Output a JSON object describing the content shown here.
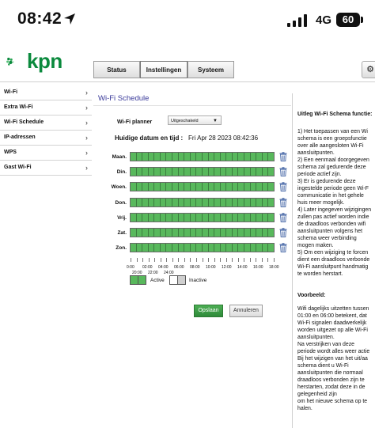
{
  "status_bar": {
    "time": "08:42",
    "network": "4G",
    "battery": "60"
  },
  "header": {
    "logo_text": "kpn",
    "tabs": [
      {
        "label": "Status",
        "active": false
      },
      {
        "label": "Instellingen",
        "active": true
      },
      {
        "label": "Systeem",
        "active": false
      }
    ],
    "help_icon": "gear-icon"
  },
  "sidebar": {
    "items": [
      {
        "label": "Wi-Fi"
      },
      {
        "label": "Extra Wi-Fi"
      },
      {
        "label": "Wi-Fi Schedule"
      },
      {
        "label": "IP-adressen"
      },
      {
        "label": "WPS"
      },
      {
        "label": "Gast Wi-Fi"
      }
    ]
  },
  "main": {
    "title": "Wi-Fi Schedule",
    "planner_label": "Wi-Fi planner",
    "planner_value": "Uitgeschakeld",
    "date_label": "Huidige datum en tijd :",
    "date_value": "Fri Apr 28 2023 08:42:36",
    "days": [
      {
        "label": "Maan."
      },
      {
        "label": "Din."
      },
      {
        "label": "Woen."
      },
      {
        "label": "Don."
      },
      {
        "label": "Vrij."
      },
      {
        "label": "Zat."
      },
      {
        "label": "Zon."
      }
    ],
    "time_labels": [
      "0:00",
      "02:00",
      "04:00",
      "06:00",
      "08:00",
      "10:00",
      "12:00",
      "14:00",
      "16:00",
      "18:00"
    ],
    "time_labels_bottom": [
      "20:00",
      "22:00",
      "24:00"
    ],
    "legend_active": "Active",
    "legend_inactive": "Inactive",
    "save_label": "Opslaan",
    "cancel_label": "Annuleren",
    "colors": {
      "active": "#58b85c",
      "inactive": "#ffffff"
    }
  },
  "help": {
    "title": "Uitleg Wi-Fi Schema functie:",
    "body": "1) Het toepassen van een Wi\nschema is een groepsfunctie\nover alle aangesloten Wi-Fi\naansluitpunten.\n2) Een eenmaal doorgegeven\nschema zal gedurende deze\nperiode actief zijn.\n3) Er is gedurende deze\ningestelde periode geen Wi-F\ncommunicatie in het gehele\nhuis meer mogelijk.\n4) Later ingegeven wijzigingen\nzullen pas actief worden indie\nde draadloos verbonden wifi\naansluitpunten volgens het\nschema weer verbinding\nmogen maken.\n5) Om een wijziging te forcen\ndient een draadloos verbonde\nWi-Fi aansluitpunt handmatig\nte worden herstart.",
    "example_title": "Voorbeeld:",
    "example_body": "Wifi dagelijks uitzetten tussen\n01:00 en 06:00 betekent, dat\nWi-Fi signalen daadwerkelijk\nworden uitgezet op alle Wi-Fi\naansluitpunten.\nNa verstrijken van deze\nperiode wordt alles weer actie\nBij het wijzigen van het uit/aa\nschema dient u Wi-Fi\naansluitpunten die normaal\ndraadloos verbonden zijn te\nherstarten, zodat deze in de\ngelegenheid zijn\nom het nieuwe schema op te\nhalen."
  }
}
